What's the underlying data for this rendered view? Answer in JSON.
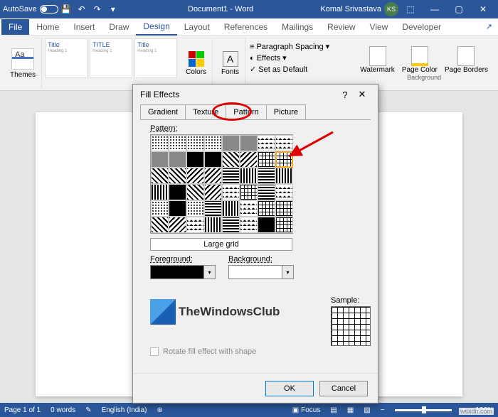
{
  "titlebar": {
    "autosave": "AutoSave",
    "doc_title": "Document1 - Word",
    "user_name": "Komal Srivastava",
    "user_initials": "KS"
  },
  "ribbon_tabs": {
    "file": "File",
    "home": "Home",
    "insert": "Insert",
    "draw": "Draw",
    "design": "Design",
    "layout": "Layout",
    "references": "References",
    "mailings": "Mailings",
    "review": "Review",
    "view": "View",
    "developer": "Developer"
  },
  "ribbon": {
    "themes": "Themes",
    "style1_title": "Title",
    "style1_sub": "Heading 1",
    "style2_title": "TITLE",
    "style2_sub": "Heading 1",
    "style3_title": "Title",
    "style3_sub": "Heading 1",
    "colors": "Colors",
    "fonts": "Fonts",
    "para_spacing": "Paragraph Spacing",
    "effects": "Effects",
    "set_default": "Set as Default",
    "watermark": "Watermark",
    "page_color": "Page Color",
    "page_borders": "Page Borders",
    "background_group": "Background"
  },
  "dialog": {
    "title": "Fill Effects",
    "tabs": {
      "gradient": "Gradient",
      "texture": "Texture",
      "pattern": "Pattern",
      "picture": "Picture"
    },
    "pattern_label": "Pattern:",
    "pattern_name": "Large grid",
    "foreground": "Foreground:",
    "background": "Background:",
    "sample": "Sample:",
    "rotate": "Rotate fill effect with shape",
    "ok": "OK",
    "cancel": "Cancel"
  },
  "watermark_text": "TheWindowsClub",
  "statusbar": {
    "page": "Page 1 of 1",
    "words": "0 words",
    "lang": "English (India)",
    "focus": "Focus",
    "zoom": "100%"
  },
  "wsx": "wsxdn.com"
}
